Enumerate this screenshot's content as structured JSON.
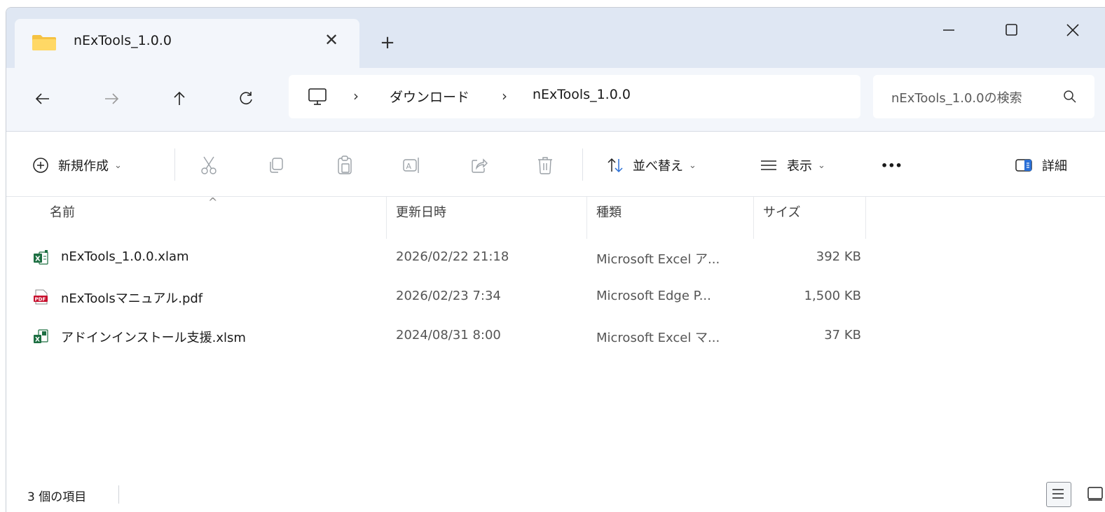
{
  "window": {
    "tab_title": "nExTools_1.0.0",
    "tab_close": "✕",
    "new_tab": "+"
  },
  "address": {
    "breadcrumb": [
      "ダウンロード",
      "nExTools_1.0.0"
    ],
    "separator": "›",
    "search_placeholder": "nExTools_1.0.0の検索"
  },
  "toolbar": {
    "new_label": "新規作成",
    "sort_label": "並べ替え",
    "view_label": "表示",
    "more_label": "•••",
    "details_label": "詳細",
    "chevron": "⌄"
  },
  "columns": {
    "name": "名前",
    "modified": "更新日時",
    "type": "種類",
    "size": "サイズ",
    "sort_indicator": "^"
  },
  "files": [
    {
      "name": "nExTools_1.0.0.xlam",
      "modified": "2026/02/22 21:18",
      "type": "Microsoft Excel ア...",
      "size": "392 KB",
      "icon": "excel-addin-icon"
    },
    {
      "name": "nExToolsマニュアル.pdf",
      "modified": "2026/02/23 7:34",
      "type": "Microsoft Edge P...",
      "size": "1,500 KB",
      "icon": "pdf-icon"
    },
    {
      "name": "アドインインストール支援.xlsm",
      "modified": "2024/08/31 8:00",
      "type": "Microsoft Excel マ...",
      "size": "37 KB",
      "icon": "excel-macro-icon"
    }
  ],
  "status": {
    "item_count": "3 個の項目"
  },
  "colors": {
    "titlebar_bg": "#dfe7f3",
    "addressrow_bg": "#f3f6fb",
    "excel_green": "#1d6f42",
    "pdf_red": "#c8102e",
    "folder_yellow": "#f5c242"
  }
}
